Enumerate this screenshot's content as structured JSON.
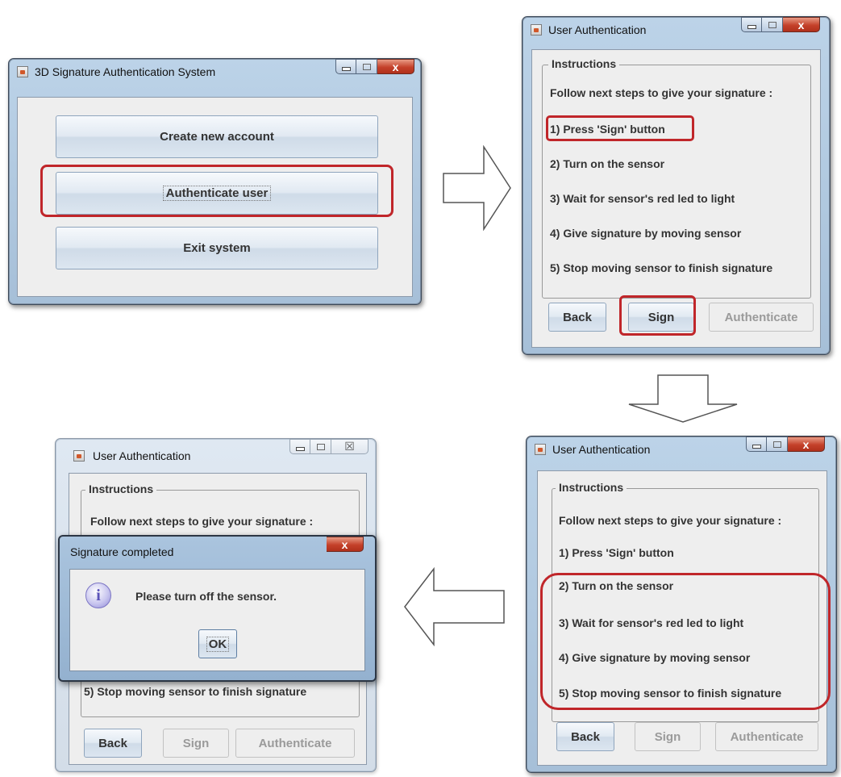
{
  "main_window": {
    "title": "3D Signature Authentication System",
    "buttons": [
      "Create new account",
      "Authenticate user",
      "Exit system"
    ]
  },
  "auth_window": {
    "title": "User Authentication",
    "instructions_legend": "Instructions",
    "intro": "Follow next steps to give your signature :",
    "steps": [
      "1) Press 'Sign' button",
      "2) Turn on the sensor",
      "3) Wait for sensor's red led to light",
      "4) Give signature by moving sensor",
      "5) Stop moving sensor to finish signature"
    ],
    "back_label": "Back",
    "sign_label": "Sign",
    "authenticate_label": "Authenticate"
  },
  "dialog": {
    "title": "Signature completed",
    "message": "Please turn off the sensor.",
    "ok_label": "OK"
  },
  "icons": {
    "window_icon": "java-cup-icon",
    "dialog_icon": "info-icon",
    "close_glyph": "x",
    "close_glyph_inactive": "☒"
  },
  "colors": {
    "highlight": "#c0262a",
    "close_button": "#c4412a",
    "titlebar": "#bcd3e8"
  }
}
